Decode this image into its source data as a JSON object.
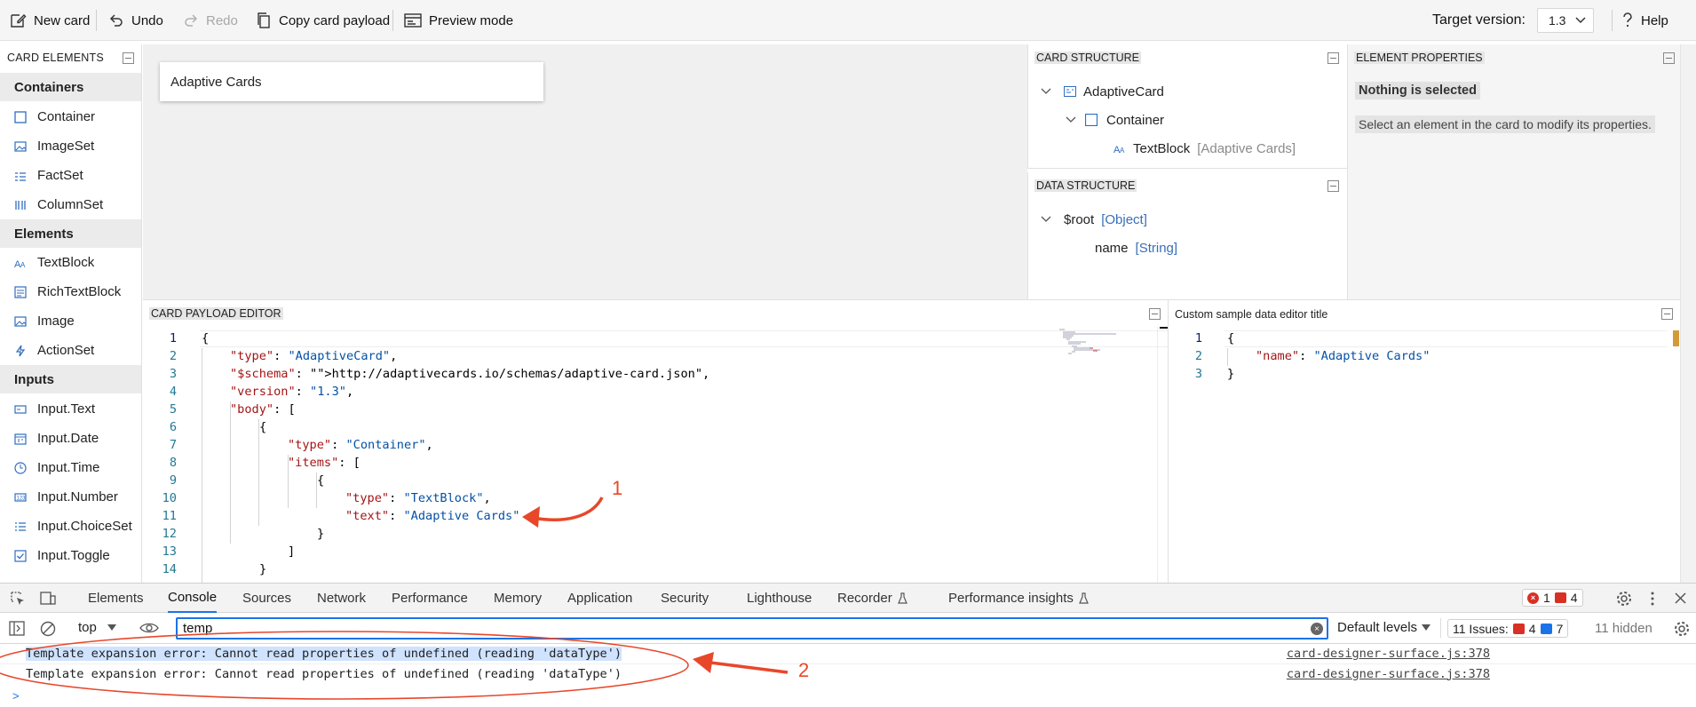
{
  "toolbar": {
    "new_card": "New card",
    "undo": "Undo",
    "redo": "Redo",
    "copy_payload": "Copy card payload",
    "preview_mode": "Preview mode",
    "target_version_label": "Target version:",
    "target_version_value": "1.3",
    "help": "Help"
  },
  "palette": {
    "title": "CARD ELEMENTS",
    "categories": [
      {
        "label": "Containers",
        "items": [
          {
            "label": "Container",
            "icon": "container-icon"
          },
          {
            "label": "ImageSet",
            "icon": "imageset-icon"
          },
          {
            "label": "FactSet",
            "icon": "factset-icon"
          },
          {
            "label": "ColumnSet",
            "icon": "columnset-icon"
          }
        ]
      },
      {
        "label": "Elements",
        "items": [
          {
            "label": "TextBlock",
            "icon": "textblock-icon"
          },
          {
            "label": "RichTextBlock",
            "icon": "richtextblock-icon"
          },
          {
            "label": "Image",
            "icon": "image-icon"
          },
          {
            "label": "ActionSet",
            "icon": "actionset-icon"
          }
        ]
      },
      {
        "label": "Inputs",
        "items": [
          {
            "label": "Input.Text",
            "icon": "input-text-icon"
          },
          {
            "label": "Input.Date",
            "icon": "input-date-icon"
          },
          {
            "label": "Input.Time",
            "icon": "input-time-icon"
          },
          {
            "label": "Input.Number",
            "icon": "input-number-icon"
          },
          {
            "label": "Input.ChoiceSet",
            "icon": "input-choiceset-icon"
          },
          {
            "label": "Input.Toggle",
            "icon": "input-toggle-icon"
          }
        ]
      }
    ]
  },
  "surface": {
    "card_text": "Adaptive Cards"
  },
  "card_structure": {
    "title": "CARD STRUCTURE",
    "nodes": [
      {
        "label": "AdaptiveCard",
        "extra": ""
      },
      {
        "label": "Container",
        "extra": ""
      },
      {
        "label": "TextBlock",
        "extra": "[Adaptive Cards]"
      }
    ]
  },
  "data_structure": {
    "title": "DATA STRUCTURE",
    "nodes": [
      {
        "label": "$root",
        "type": "[Object]"
      },
      {
        "label": "name",
        "type": "[String]"
      }
    ]
  },
  "element_properties": {
    "title": "ELEMENT PROPERTIES",
    "nothing": "Nothing is selected",
    "message": "Select an element in the card to modify its properties."
  },
  "payload_editor": {
    "title": "CARD PAYLOAD EDITOR",
    "line_numbers": [
      "1",
      "2",
      "3",
      "4",
      "5",
      "6",
      "7",
      "8",
      "9",
      "10",
      "11",
      "12",
      "13",
      "14"
    ],
    "lines": [
      "{",
      "\"type\": \"AdaptiveCard\",",
      "\"$schema\": \"http://adaptivecards.io/schemas/adaptive-card.json\",",
      "\"version\": \"1.3\",",
      "\"body\": [",
      "{",
      "\"type\": \"Container\",",
      "\"items\": [",
      "{",
      "\"type\": \"TextBlock\",",
      "\"text\": \"Adaptive Cards\"",
      "}",
      "]",
      "}"
    ]
  },
  "sample_editor": {
    "title": "Custom sample data editor title",
    "line_numbers": [
      "1",
      "2",
      "3"
    ],
    "lines": [
      "{",
      "\"name\": \"Adaptive Cards\"",
      "}"
    ]
  },
  "devtools": {
    "tabs": [
      "Elements",
      "Console",
      "Sources",
      "Network",
      "Performance",
      "Memory",
      "Application",
      "Security",
      "Lighthouse",
      "Recorder",
      "Performance insights"
    ],
    "active_tab": "Console",
    "error_count": "1",
    "warning_count": "4",
    "context": "top",
    "filter_value": "temp",
    "levels": "Default levels",
    "issues_label": "11 Issues:",
    "issues_errors": "4",
    "issues_info": "7",
    "hidden": "11 hidden",
    "messages": [
      {
        "text": "Template expansion error: Cannot read properties of undefined (reading 'dataType')",
        "source": "card-designer-surface.js:378"
      },
      {
        "text": "Template expansion error: Cannot read properties of undefined (reading 'dataType')",
        "source": "card-designer-surface.js:378"
      }
    ],
    "prompt": ">"
  },
  "annotations": {
    "label_1": "1",
    "label_2": "2",
    "color": "#e8472a"
  }
}
